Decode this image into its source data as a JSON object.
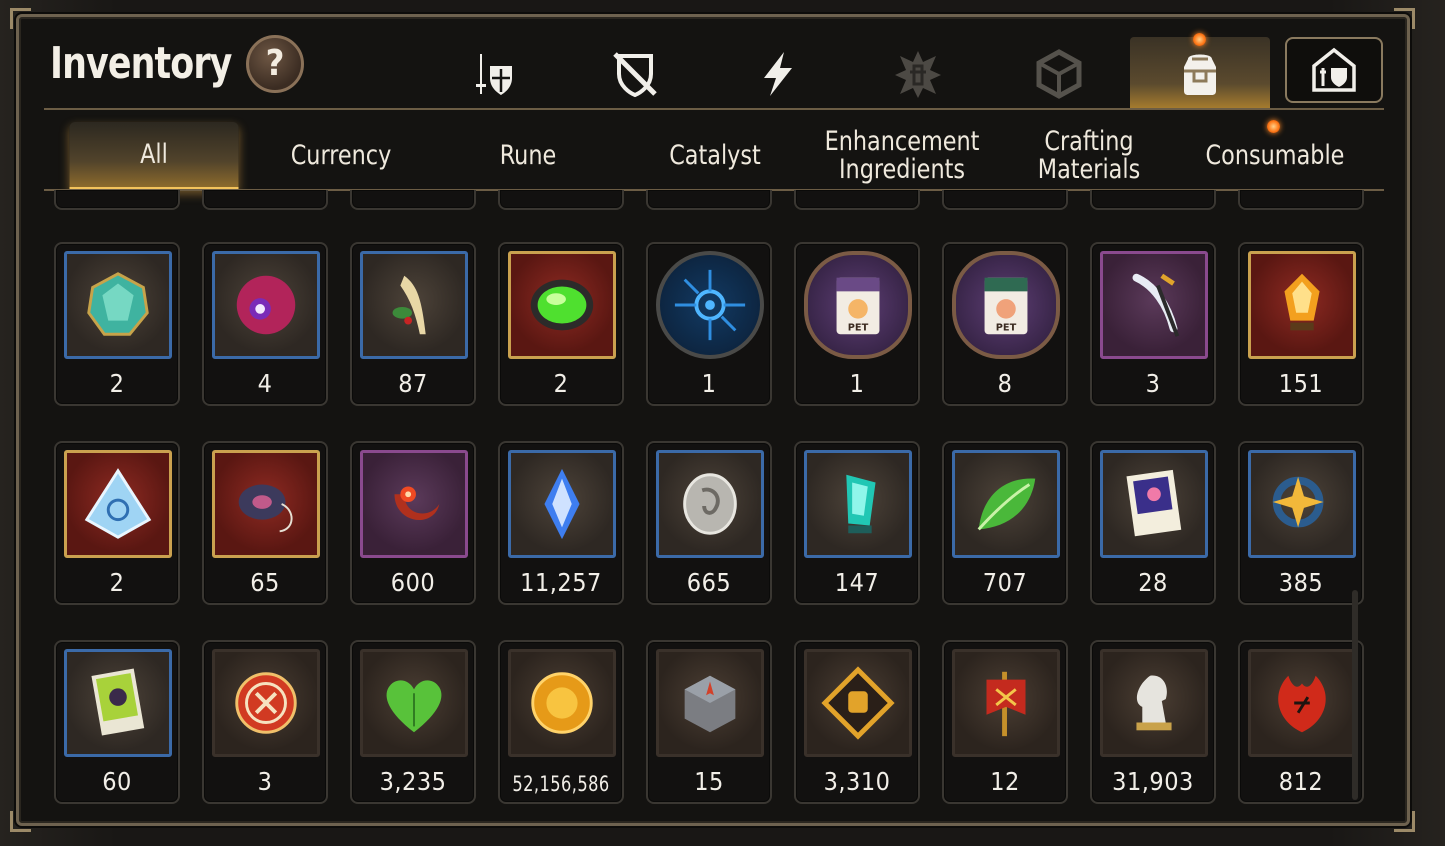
{
  "header": {
    "title": "Inventory",
    "help_label": "?"
  },
  "top_tabs": [
    {
      "icon": "sword-shield-icon",
      "active": false
    },
    {
      "icon": "crossed-shield-icon",
      "active": false
    },
    {
      "icon": "lightning-icon",
      "active": false
    },
    {
      "icon": "crest-icon",
      "active": false
    },
    {
      "icon": "cube-icon",
      "active": false
    },
    {
      "icon": "bag-icon",
      "active": true
    },
    {
      "icon": "guild-castle-icon",
      "active": false
    }
  ],
  "sub_tabs": [
    {
      "label": "All",
      "active": true
    },
    {
      "label": "Currency",
      "active": false
    },
    {
      "label": "Rune",
      "active": false
    },
    {
      "label": "Catalyst",
      "active": false
    },
    {
      "label": "Enhancement\nIngredients",
      "active": false
    },
    {
      "label": "Crafting\nMaterials",
      "active": false
    },
    {
      "label": "Consumable",
      "active": false
    }
  ],
  "items": [
    {
      "icon": "teal-gem-icon",
      "count": "2",
      "frame": "blue"
    },
    {
      "icon": "purple-eye-orb-icon",
      "count": "4",
      "frame": "blue"
    },
    {
      "icon": "ginseng-root-icon",
      "count": "87",
      "frame": "blue"
    },
    {
      "icon": "green-soul-stone-icon",
      "count": "2",
      "frame": "red"
    },
    {
      "icon": "blue-rune-circle-icon",
      "count": "1",
      "frame": "round"
    },
    {
      "icon": "pet-food-bag-icon",
      "count": "1",
      "frame": "hex"
    },
    {
      "icon": "pet-food-bag-icon",
      "count": "8",
      "frame": "hex"
    },
    {
      "icon": "feather-staff-icon",
      "count": "3",
      "frame": "purple"
    },
    {
      "icon": "amber-crystal-icon",
      "count": "151",
      "frame": "red"
    },
    {
      "icon": "tri-crystal-icon",
      "count": "2",
      "frame": "red"
    },
    {
      "icon": "ring-amulet-icon",
      "count": "65",
      "frame": "red"
    },
    {
      "icon": "flower-moon-amulet-icon",
      "count": "600",
      "frame": "purple"
    },
    {
      "icon": "blue-crystal-shard-icon",
      "count": "11,257",
      "frame": "blue"
    },
    {
      "icon": "silver-coin-icon",
      "count": "665",
      "frame": "blue"
    },
    {
      "icon": "cyan-crystal-icon",
      "count": "147",
      "frame": "blue"
    },
    {
      "icon": "green-leaf-icon",
      "count": "707",
      "frame": "blue"
    },
    {
      "icon": "paw-certificate-icon",
      "count": "28",
      "frame": "blue"
    },
    {
      "icon": "star-compass-amulet-icon",
      "count": "385",
      "frame": "blue"
    },
    {
      "icon": "green-card-icon",
      "count": "60",
      "frame": "blue"
    },
    {
      "icon": "sword-bottlecap-icon",
      "count": "3",
      "frame": "brown"
    },
    {
      "icon": "green-heart-icon",
      "count": "3,235",
      "frame": "brown"
    },
    {
      "icon": "gold-sun-coin-icon",
      "count": "52,156,586",
      "frame": "brown"
    },
    {
      "icon": "stone-compass-icon",
      "count": "15",
      "frame": "brown"
    },
    {
      "icon": "fist-emblem-icon",
      "count": "3,310",
      "frame": "brown"
    },
    {
      "icon": "war-banner-icon",
      "count": "12",
      "frame": "brown"
    },
    {
      "icon": "knight-chess-icon",
      "count": "31,903",
      "frame": "brown"
    },
    {
      "icon": "red-leaf-icon",
      "count": "812",
      "frame": "brown"
    }
  ],
  "colors": {
    "accent": "#f4c35c",
    "frame_border": "#6e624f",
    "notification": "#ff7b1a"
  }
}
